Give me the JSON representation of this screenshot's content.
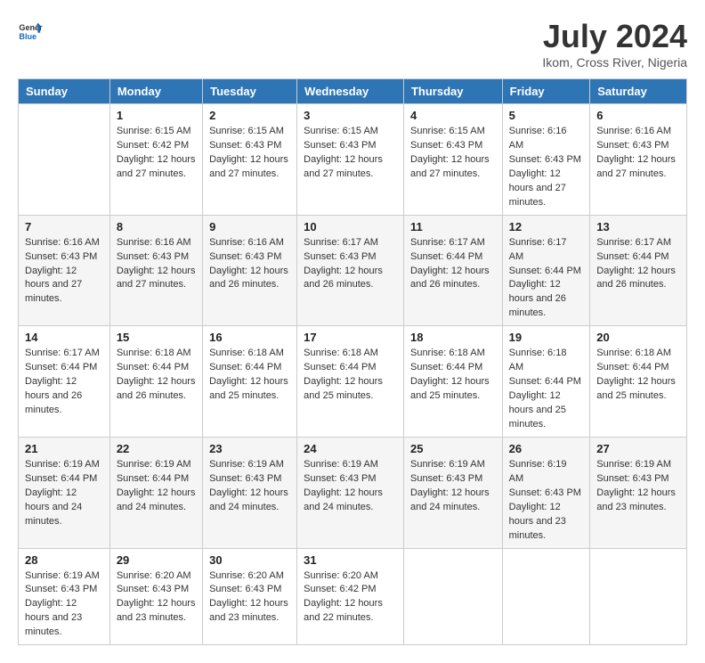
{
  "logo": {
    "text_general": "General",
    "text_blue": "Blue"
  },
  "header": {
    "month": "July 2024",
    "location": "Ikom, Cross River, Nigeria"
  },
  "weekdays": [
    "Sunday",
    "Monday",
    "Tuesday",
    "Wednesday",
    "Thursday",
    "Friday",
    "Saturday"
  ],
  "weeks": [
    [
      {
        "day": "",
        "sunrise": "",
        "sunset": "",
        "daylight": ""
      },
      {
        "day": "1",
        "sunrise": "Sunrise: 6:15 AM",
        "sunset": "Sunset: 6:42 PM",
        "daylight": "Daylight: 12 hours and 27 minutes."
      },
      {
        "day": "2",
        "sunrise": "Sunrise: 6:15 AM",
        "sunset": "Sunset: 6:43 PM",
        "daylight": "Daylight: 12 hours and 27 minutes."
      },
      {
        "day": "3",
        "sunrise": "Sunrise: 6:15 AM",
        "sunset": "Sunset: 6:43 PM",
        "daylight": "Daylight: 12 hours and 27 minutes."
      },
      {
        "day": "4",
        "sunrise": "Sunrise: 6:15 AM",
        "sunset": "Sunset: 6:43 PM",
        "daylight": "Daylight: 12 hours and 27 minutes."
      },
      {
        "day": "5",
        "sunrise": "Sunrise: 6:16 AM",
        "sunset": "Sunset: 6:43 PM",
        "daylight": "Daylight: 12 hours and 27 minutes."
      },
      {
        "day": "6",
        "sunrise": "Sunrise: 6:16 AM",
        "sunset": "Sunset: 6:43 PM",
        "daylight": "Daylight: 12 hours and 27 minutes."
      }
    ],
    [
      {
        "day": "7",
        "sunrise": "Sunrise: 6:16 AM",
        "sunset": "Sunset: 6:43 PM",
        "daylight": "Daylight: 12 hours and 27 minutes."
      },
      {
        "day": "8",
        "sunrise": "Sunrise: 6:16 AM",
        "sunset": "Sunset: 6:43 PM",
        "daylight": "Daylight: 12 hours and 27 minutes."
      },
      {
        "day": "9",
        "sunrise": "Sunrise: 6:16 AM",
        "sunset": "Sunset: 6:43 PM",
        "daylight": "Daylight: 12 hours and 26 minutes."
      },
      {
        "day": "10",
        "sunrise": "Sunrise: 6:17 AM",
        "sunset": "Sunset: 6:43 PM",
        "daylight": "Daylight: 12 hours and 26 minutes."
      },
      {
        "day": "11",
        "sunrise": "Sunrise: 6:17 AM",
        "sunset": "Sunset: 6:44 PM",
        "daylight": "Daylight: 12 hours and 26 minutes."
      },
      {
        "day": "12",
        "sunrise": "Sunrise: 6:17 AM",
        "sunset": "Sunset: 6:44 PM",
        "daylight": "Daylight: 12 hours and 26 minutes."
      },
      {
        "day": "13",
        "sunrise": "Sunrise: 6:17 AM",
        "sunset": "Sunset: 6:44 PM",
        "daylight": "Daylight: 12 hours and 26 minutes."
      }
    ],
    [
      {
        "day": "14",
        "sunrise": "Sunrise: 6:17 AM",
        "sunset": "Sunset: 6:44 PM",
        "daylight": "Daylight: 12 hours and 26 minutes."
      },
      {
        "day": "15",
        "sunrise": "Sunrise: 6:18 AM",
        "sunset": "Sunset: 6:44 PM",
        "daylight": "Daylight: 12 hours and 26 minutes."
      },
      {
        "day": "16",
        "sunrise": "Sunrise: 6:18 AM",
        "sunset": "Sunset: 6:44 PM",
        "daylight": "Daylight: 12 hours and 25 minutes."
      },
      {
        "day": "17",
        "sunrise": "Sunrise: 6:18 AM",
        "sunset": "Sunset: 6:44 PM",
        "daylight": "Daylight: 12 hours and 25 minutes."
      },
      {
        "day": "18",
        "sunrise": "Sunrise: 6:18 AM",
        "sunset": "Sunset: 6:44 PM",
        "daylight": "Daylight: 12 hours and 25 minutes."
      },
      {
        "day": "19",
        "sunrise": "Sunrise: 6:18 AM",
        "sunset": "Sunset: 6:44 PM",
        "daylight": "Daylight: 12 hours and 25 minutes."
      },
      {
        "day": "20",
        "sunrise": "Sunrise: 6:18 AM",
        "sunset": "Sunset: 6:44 PM",
        "daylight": "Daylight: 12 hours and 25 minutes."
      }
    ],
    [
      {
        "day": "21",
        "sunrise": "Sunrise: 6:19 AM",
        "sunset": "Sunset: 6:44 PM",
        "daylight": "Daylight: 12 hours and 24 minutes."
      },
      {
        "day": "22",
        "sunrise": "Sunrise: 6:19 AM",
        "sunset": "Sunset: 6:44 PM",
        "daylight": "Daylight: 12 hours and 24 minutes."
      },
      {
        "day": "23",
        "sunrise": "Sunrise: 6:19 AM",
        "sunset": "Sunset: 6:43 PM",
        "daylight": "Daylight: 12 hours and 24 minutes."
      },
      {
        "day": "24",
        "sunrise": "Sunrise: 6:19 AM",
        "sunset": "Sunset: 6:43 PM",
        "daylight": "Daylight: 12 hours and 24 minutes."
      },
      {
        "day": "25",
        "sunrise": "Sunrise: 6:19 AM",
        "sunset": "Sunset: 6:43 PM",
        "daylight": "Daylight: 12 hours and 24 minutes."
      },
      {
        "day": "26",
        "sunrise": "Sunrise: 6:19 AM",
        "sunset": "Sunset: 6:43 PM",
        "daylight": "Daylight: 12 hours and 23 minutes."
      },
      {
        "day": "27",
        "sunrise": "Sunrise: 6:19 AM",
        "sunset": "Sunset: 6:43 PM",
        "daylight": "Daylight: 12 hours and 23 minutes."
      }
    ],
    [
      {
        "day": "28",
        "sunrise": "Sunrise: 6:19 AM",
        "sunset": "Sunset: 6:43 PM",
        "daylight": "Daylight: 12 hours and 23 minutes."
      },
      {
        "day": "29",
        "sunrise": "Sunrise: 6:20 AM",
        "sunset": "Sunset: 6:43 PM",
        "daylight": "Daylight: 12 hours and 23 minutes."
      },
      {
        "day": "30",
        "sunrise": "Sunrise: 6:20 AM",
        "sunset": "Sunset: 6:43 PM",
        "daylight": "Daylight: 12 hours and 23 minutes."
      },
      {
        "day": "31",
        "sunrise": "Sunrise: 6:20 AM",
        "sunset": "Sunset: 6:42 PM",
        "daylight": "Daylight: 12 hours and 22 minutes."
      },
      {
        "day": "",
        "sunrise": "",
        "sunset": "",
        "daylight": ""
      },
      {
        "day": "",
        "sunrise": "",
        "sunset": "",
        "daylight": ""
      },
      {
        "day": "",
        "sunrise": "",
        "sunset": "",
        "daylight": ""
      }
    ]
  ]
}
